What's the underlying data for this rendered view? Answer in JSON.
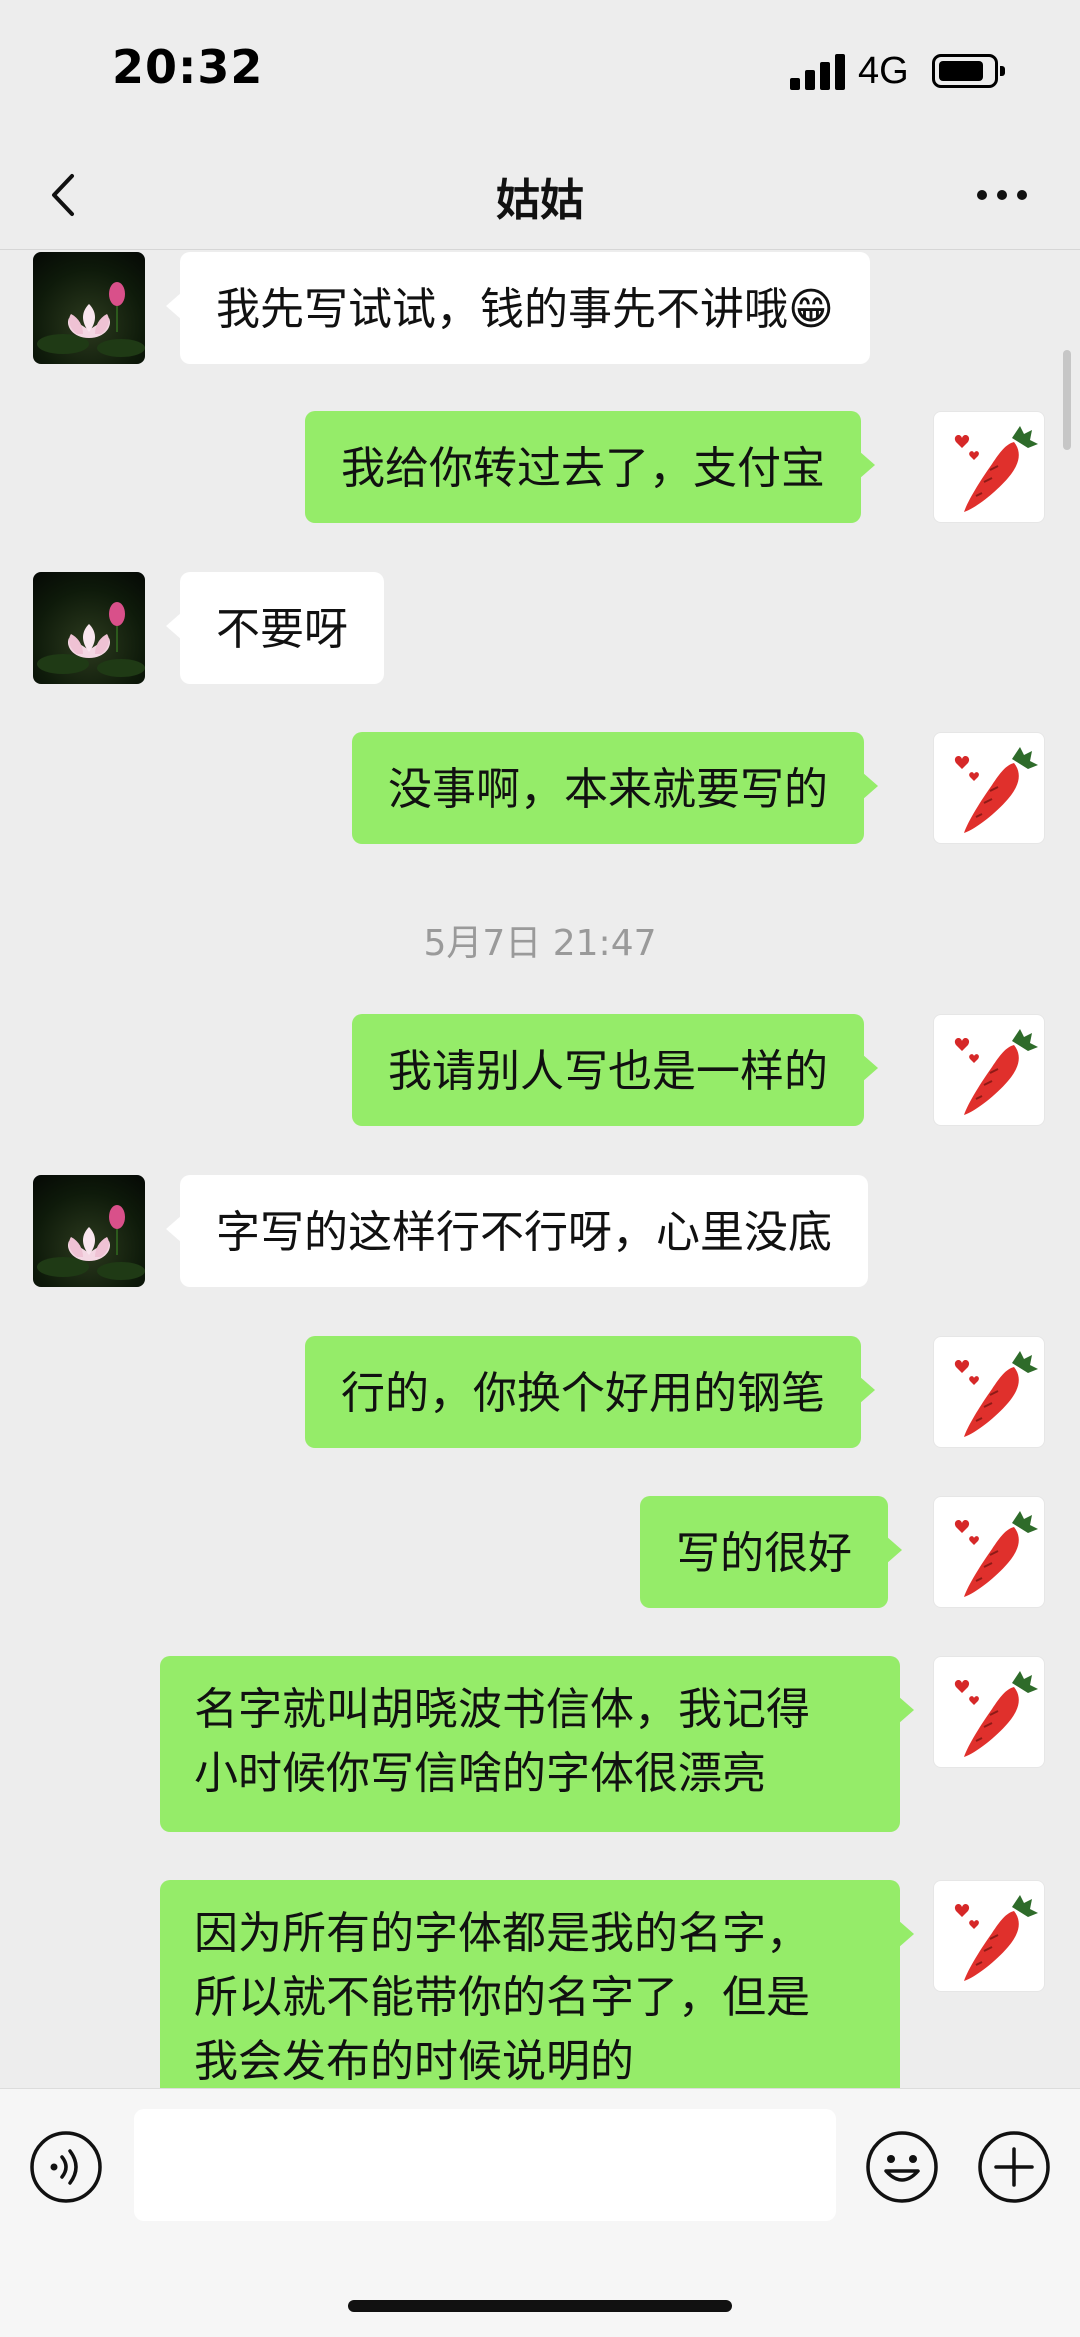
{
  "status_bar": {
    "time": "20:32",
    "network": "4G",
    "battery_level": 0.85
  },
  "nav": {
    "title": "姑姑",
    "back_icon": "chevron-left-icon",
    "more_icon": "more-dots-icon"
  },
  "messages": [
    {
      "side": "left",
      "text": "我先写试试，钱的事先不讲哦😁"
    },
    {
      "side": "right",
      "text": "我给你转过去了，支付宝"
    },
    {
      "side": "left",
      "text": "不要呀"
    },
    {
      "side": "right",
      "text": "没事啊，本来就要写的"
    },
    {
      "side": "right",
      "text": "我请别人写也是一样的"
    },
    {
      "side": "left",
      "text": "字写的这样行不行呀，心里没底"
    },
    {
      "side": "right",
      "text": "行的，你换个好用的钢笔"
    },
    {
      "side": "right",
      "text": "写的很好"
    },
    {
      "side": "right",
      "lines": [
        "名字就叫胡晓波书信体，我记得",
        "小时候你写信啥的字体很漂亮"
      ]
    },
    {
      "side": "right",
      "lines": [
        "因为所有的字体都是我的名字，",
        "所以就不能带你的名字了，但是",
        "我会发布的时候说明的"
      ]
    }
  ],
  "timestamp": "5月7日 21:47",
  "input_bar": {
    "voice_icon": "voice-icon",
    "emoji_icon": "emoji-icon",
    "plus_icon": "plus-icon",
    "input_value": ""
  }
}
